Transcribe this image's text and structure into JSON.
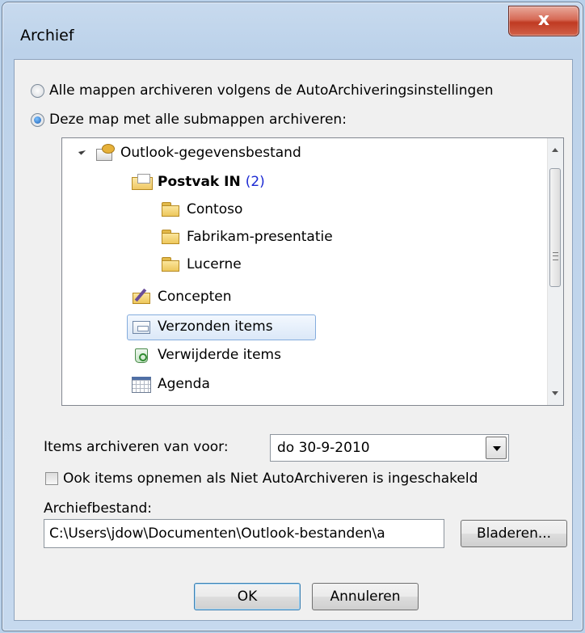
{
  "window": {
    "title": "Archief",
    "close_label": "x"
  },
  "options": {
    "all_folders": {
      "label": "Alle mappen archiveren volgens de AutoArchiveringsinstellingen",
      "selected": false
    },
    "this_folder": {
      "label": "Deze map met alle submappen archiveren:",
      "selected": true
    }
  },
  "tree": {
    "root": {
      "label": "Outlook-gegevensbestand",
      "icon": "data-file-icon"
    },
    "inbox": {
      "label": "Postvak IN",
      "count": "(2)",
      "icon": "inbox-icon"
    },
    "contoso": {
      "label": "Contoso",
      "icon": "folder-icon"
    },
    "fabrikam": {
      "label": "Fabrikam-presentatie",
      "icon": "folder-icon"
    },
    "lucerne": {
      "label": "Lucerne",
      "icon": "folder-icon"
    },
    "drafts": {
      "label": "Concepten",
      "icon": "drafts-icon"
    },
    "sent": {
      "label": "Verzonden items",
      "icon": "sent-items-icon",
      "selected": true
    },
    "deleted": {
      "label": "Verwijderde items",
      "icon": "recycle-icon"
    },
    "calendar": {
      "label": "Agenda",
      "icon": "calendar-icon"
    }
  },
  "archive_before": {
    "label": "Items archiveren van voor:",
    "value": "do 30-9-2010"
  },
  "include_no_autoarchive": {
    "label": "Ook items opnemen als Niet AutoArchiveren is ingeschakeld",
    "checked": false
  },
  "archive_file": {
    "label": "Archiefbestand:",
    "value": "C:\\Users\\jdow\\Documenten\\Outlook-bestanden\\a",
    "browse_label": "Bladeren..."
  },
  "buttons": {
    "ok": "OK",
    "cancel": "Annuleren"
  },
  "colors": {
    "accent": "#1a5db5",
    "selection_border": "#84acdd",
    "count_color": "#1c2ad3",
    "close_red": "#c03a22"
  }
}
